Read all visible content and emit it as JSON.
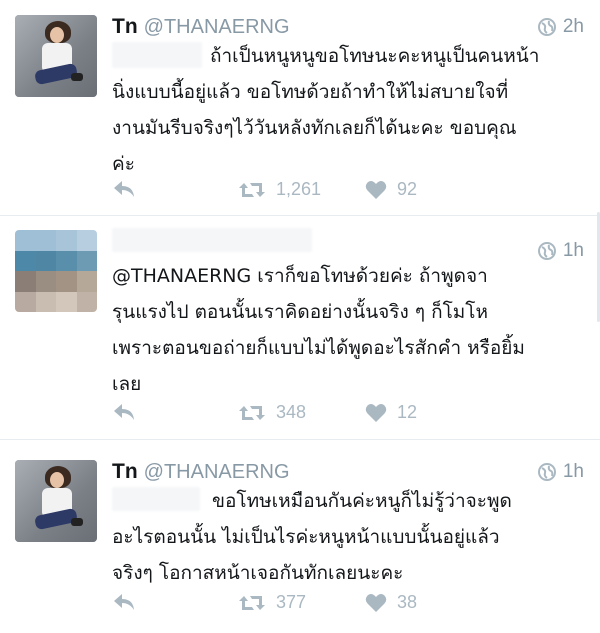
{
  "colors": {
    "icon_gray": "#aab8c2",
    "handle_gray": "#8899a6",
    "text": "#14171a",
    "divider": "#e6ecf0"
  },
  "tweets": [
    {
      "name": "Tn",
      "handle": "@THANAERNG",
      "time": "2h",
      "lines": [
        "ถ้าเป็นหนูหนูขอโทษนะคะหนูเป็นคนหน้า",
        "นิ่งแบบนี้อยู่แล้ว ขอโทษด้วยถ้าทำให้ไม่สบายใจที่",
        "งานมันรีบจริงๆไว้วันหลังทักเลยก็ได้นะคะ ขอบคุณ",
        "ค่ะ"
      ],
      "retweets": "1,261",
      "likes": "92",
      "reply_icon": "reply-icon",
      "retweet_icon": "retweet-icon",
      "like_icon": "heart-icon"
    },
    {
      "name": "",
      "handle": "",
      "time": "1h",
      "lines": [
        "@THANAERNG เราก็ขอโทษด้วยค่ะ ถ้าพูดจา",
        "รุนแรงไป ตอนนั้นเราคิดอย่างนั้นจริง ๆ ก็โมโห",
        "เพราะตอนขอถ่ายก็แบบไม่ได้พูดอะไรสักคำ หรือยิ้ม",
        "เลย"
      ],
      "retweets": "348",
      "likes": "12"
    },
    {
      "name": "Tn",
      "handle": "@THANAERNG",
      "time": "1h",
      "lines": [
        "ขอโทษเหมือนกันค่ะหนูก็ไม่รู้ว่าจะพูด",
        "อะไรตอนนั้น ไม่เป็นไรค่ะหนูหน้าแบบนั้นอยู่แล้ว",
        "จริงๆ โอกาสหน้าเจอกันทักเลยนะคะ"
      ],
      "retweets": "377",
      "likes": "38"
    }
  ]
}
